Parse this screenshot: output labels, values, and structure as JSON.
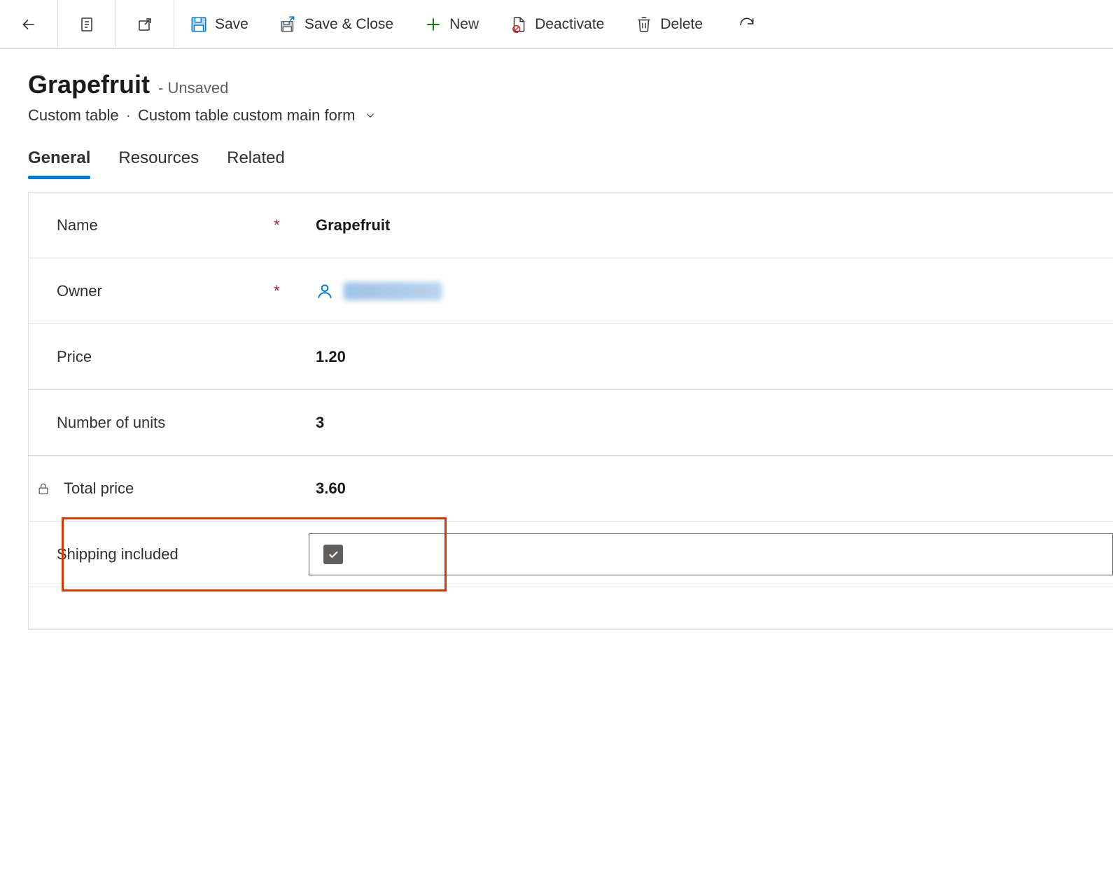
{
  "toolbar": {
    "save": "Save",
    "save_close": "Save & Close",
    "new": "New",
    "deactivate": "Deactivate",
    "delete": "Delete"
  },
  "header": {
    "title": "Grapefruit",
    "status": "- Unsaved",
    "entity": "Custom table",
    "form_name": "Custom table custom main form"
  },
  "tabs": {
    "general": "General",
    "resources": "Resources",
    "related": "Related"
  },
  "form": {
    "name_label": "Name",
    "name_value": "Grapefruit",
    "owner_label": "Owner",
    "price_label": "Price",
    "price_value": "1.20",
    "units_label": "Number of units",
    "units_value": "3",
    "total_label": "Total price",
    "total_value": "3.60",
    "shipping_label": "Shipping included",
    "shipping_checked": true
  }
}
